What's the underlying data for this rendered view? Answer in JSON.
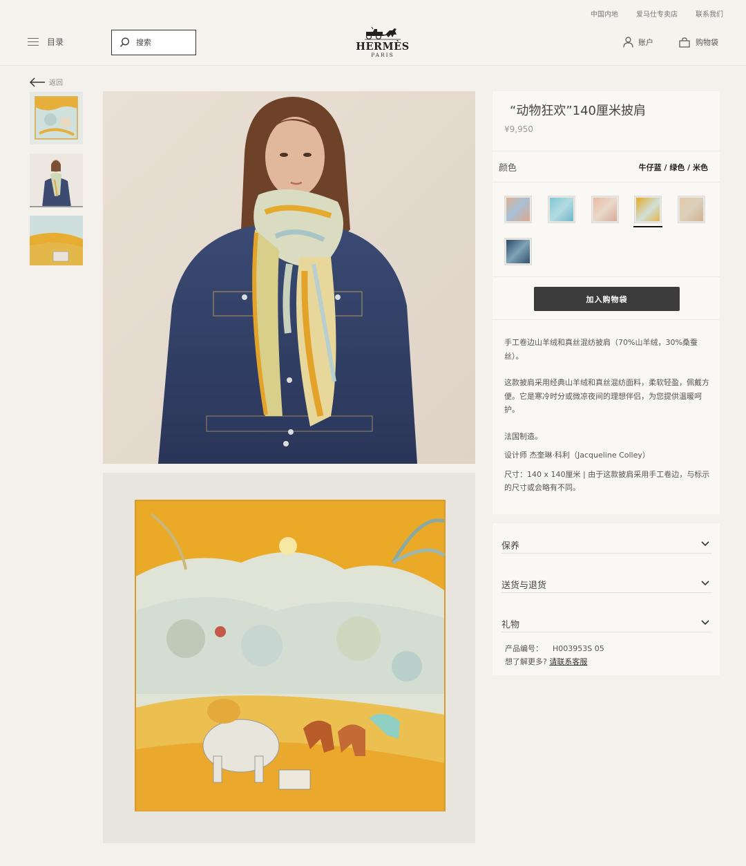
{
  "header": {
    "util_links": [
      "中国内地",
      "爱马仕专卖店",
      "联系我们"
    ],
    "menu_label": "目录",
    "search_placeholder": "搜索",
    "logo_wordmark": "HERMÈS",
    "logo_city": "PARIS",
    "account_label": "账户",
    "bag_label": "购物袋"
  },
  "nav": {
    "back_label": "返回"
  },
  "product": {
    "title": "“动物狂欢”140厘米披肩",
    "price": "¥9,950",
    "color_label": "颜色",
    "color_value": "牛仔蓝 / 绿色 / 米色",
    "selected_swatch_index": 3,
    "add_to_bag": "加入购物袋",
    "description": [
      "手工卷边山羊绒和真丝混纺披肩（70%山羊绒，30%桑蚕丝）。",
      "这款披肩采用经典山羊绒和真丝混纺面料，柔软轻盈，佩戴方便。它是寒冷时分或微凉夜间的理想伴侣，为您提供温暖呵护。",
      "法国制造。",
      "设计师 杰奎琳·科利（Jacqueline Colley）",
      "尺寸：140 x 140厘米 | 由于这款披肩采用手工卷边，与标示的尺寸或会略有不同。"
    ]
  },
  "accordion": {
    "items": [
      "保养",
      "送货与退货",
      "礼物"
    ],
    "code_label": "产品编号：",
    "code_value": "H003953S 05",
    "more_label": "想了解更多?",
    "contact_link": "请联系客服"
  },
  "colors": {
    "page_bg": "#f4f1ec",
    "panel_bg": "#faf8f5",
    "button_bg": "#3b3b3b",
    "scarf_orange": "#e8a823",
    "denim": "#2f3f66"
  }
}
